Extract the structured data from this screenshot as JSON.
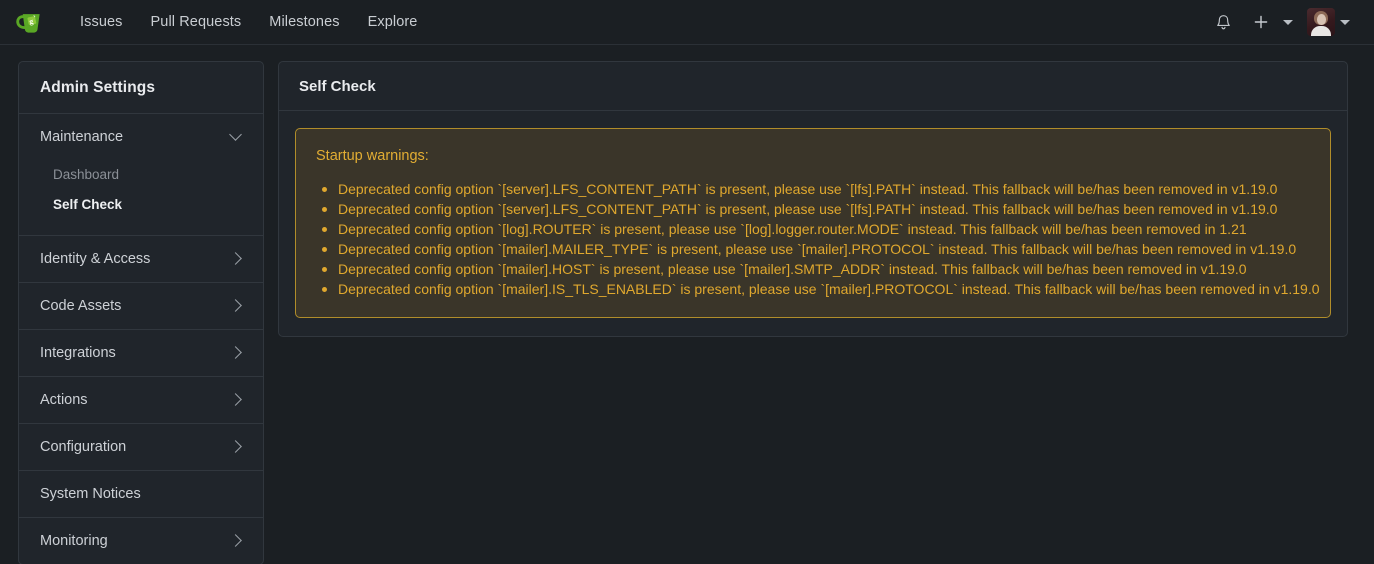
{
  "navbar": {
    "logo": {
      "name": "gitea-logo",
      "colors": {
        "cup": "#5aa725",
        "cup_dark": "#3f7d19",
        "tag": "#7fc238"
      }
    },
    "links": [
      {
        "label": "Issues",
        "name": "nav-link-issues"
      },
      {
        "label": "Pull Requests",
        "name": "nav-link-pull-requests"
      },
      {
        "label": "Milestones",
        "name": "nav-link-milestones"
      },
      {
        "label": "Explore",
        "name": "nav-link-explore"
      }
    ],
    "right": {
      "notifications_icon": "bell-icon",
      "create_icon": "plus-icon",
      "create_caret_icon": "chevron-down-icon",
      "avatar_icon": "user-avatar",
      "avatar_caret_icon": "chevron-down-icon"
    }
  },
  "sidebar": {
    "title": "Admin Settings",
    "groups": [
      {
        "label": "Maintenance",
        "name": "sidebar-item-maintenance",
        "expanded": true,
        "chevron": "chevron-down-icon",
        "children": [
          {
            "label": "Dashboard",
            "name": "sidebar-subitem-dashboard",
            "active": false
          },
          {
            "label": "Self Check",
            "name": "sidebar-subitem-self-check",
            "active": true
          }
        ]
      },
      {
        "label": "Identity & Access",
        "name": "sidebar-item-identity-access",
        "expanded": false,
        "chevron": "chevron-right-icon",
        "children": []
      },
      {
        "label": "Code Assets",
        "name": "sidebar-item-code-assets",
        "expanded": false,
        "chevron": "chevron-right-icon",
        "children": []
      },
      {
        "label": "Integrations",
        "name": "sidebar-item-integrations",
        "expanded": false,
        "chevron": "chevron-right-icon",
        "children": []
      },
      {
        "label": "Actions",
        "name": "sidebar-item-actions",
        "expanded": false,
        "chevron": "chevron-right-icon",
        "children": []
      },
      {
        "label": "Configuration",
        "name": "sidebar-item-configuration",
        "expanded": false,
        "chevron": "chevron-right-icon",
        "children": []
      },
      {
        "label": "System Notices",
        "name": "sidebar-item-system-notices",
        "expanded": false,
        "chevron": null,
        "children": []
      },
      {
        "label": "Monitoring",
        "name": "sidebar-item-monitoring",
        "expanded": false,
        "chevron": "chevron-right-icon",
        "children": []
      }
    ]
  },
  "main": {
    "panel_title": "Self Check",
    "warning": {
      "title": "Startup warnings:",
      "items": [
        "Deprecated config option `[server].LFS_CONTENT_PATH` is present, please use `[lfs].PATH` instead. This fallback will be/has been removed in v1.19.0",
        "Deprecated config option `[server].LFS_CONTENT_PATH` is present, please use `[lfs].PATH` instead. This fallback will be/has been removed in v1.19.0",
        "Deprecated config option `[log].ROUTER` is present, please use `[log].logger.router.MODE` instead. This fallback will be/has been removed in 1.21",
        "Deprecated config option `[mailer].MAILER_TYPE` is present, please use `[mailer].PROTOCOL` instead. This fallback will be/has been removed in v1.19.0",
        "Deprecated config option `[mailer].HOST` is present, please use `[mailer].SMTP_ADDR` instead. This fallback will be/has been removed in v1.19.0",
        "Deprecated config option `[mailer].IS_TLS_ENABLED` is present, please use `[mailer].PROTOCOL` instead. This fallback will be/has been removed in v1.19.0"
      ]
    }
  },
  "colors": {
    "page_bg": "#1b1f23",
    "panel_bg": "#20252b",
    "border": "#31373e",
    "text": "#dbdee2",
    "warning_text": "#e0a82e",
    "warning_bg": "#3a3529",
    "warning_border": "#b08d2a",
    "accent_green": "#5aa725"
  }
}
